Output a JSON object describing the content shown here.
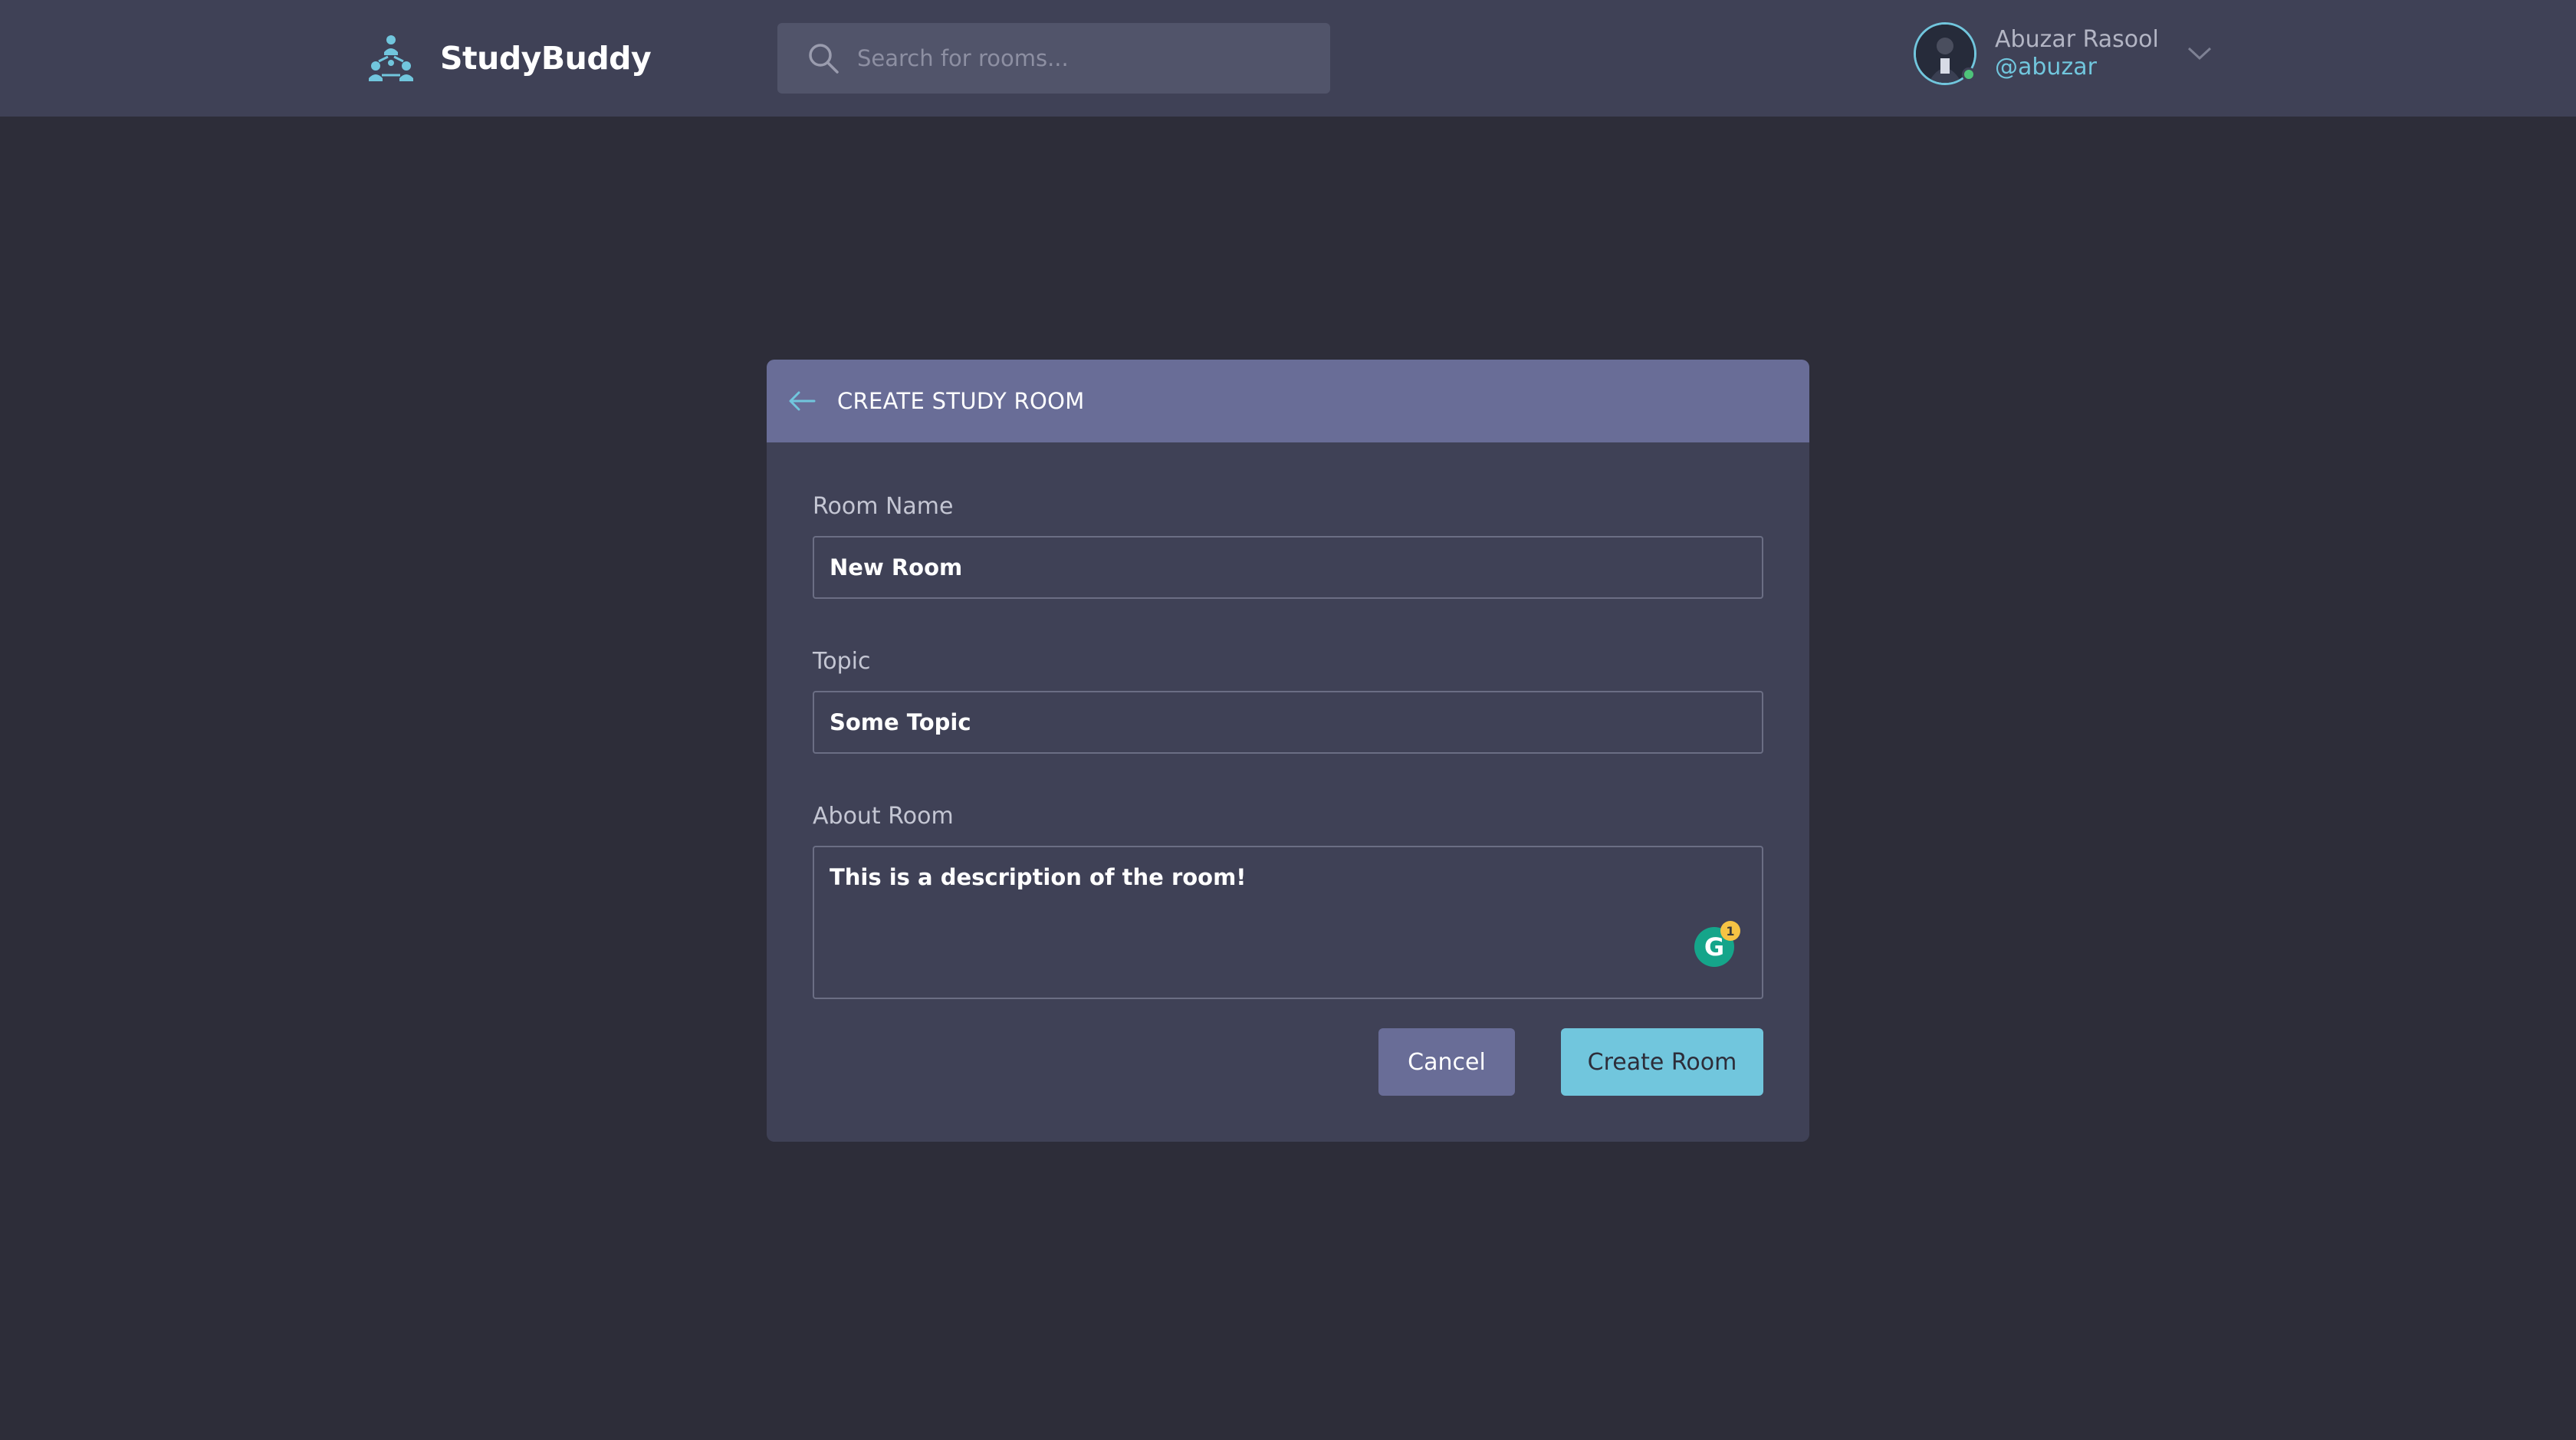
{
  "header": {
    "brand_name": "StudyBuddy",
    "search": {
      "placeholder": "Search for rooms..."
    },
    "user": {
      "name": "Abuzar Rasool",
      "handle": "@abuzar",
      "status": "online"
    },
    "icons": {
      "logo": "people-network-icon",
      "search": "search-icon",
      "menu": "chevron-down-icon"
    }
  },
  "form": {
    "title": "CREATE STUDY ROOM",
    "fields": {
      "room_name": {
        "label": "Room Name",
        "value": "New Room"
      },
      "topic": {
        "label": "Topic",
        "value": "Some Topic"
      },
      "about": {
        "label": "About Room",
        "value": "This is a description of the room!"
      }
    },
    "grammarly": {
      "letter": "G",
      "count": "1"
    },
    "buttons": {
      "cancel": "Cancel",
      "create": "Create Room"
    }
  },
  "colors": {
    "background": "#2d2d39",
    "header": "#3f4156",
    "card_header": "#696d97",
    "accent": "#71c6dd",
    "online": "#4ec37a"
  }
}
